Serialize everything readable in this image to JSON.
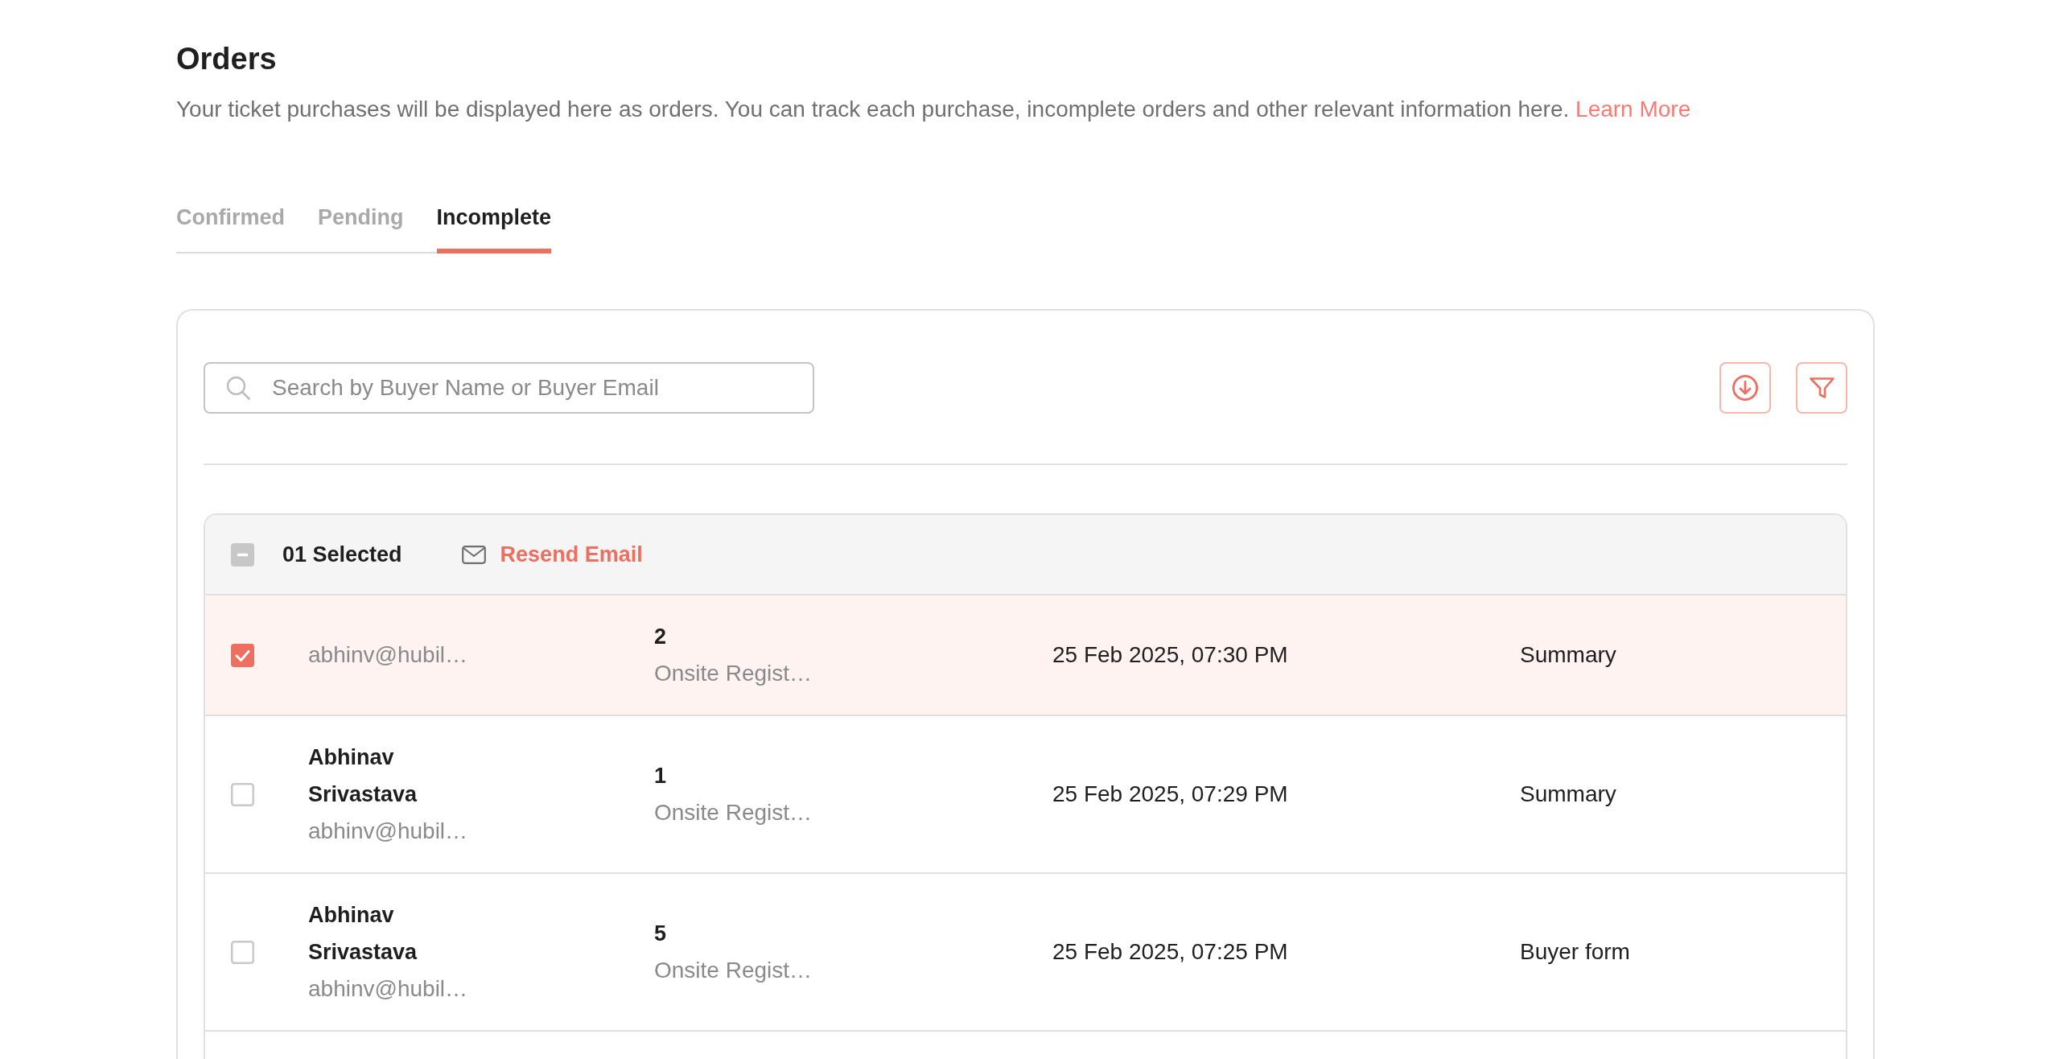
{
  "header": {
    "title": "Orders",
    "description": "Your ticket purchases will be displayed here as orders. You can track each purchase, incomplete orders and other relevant information here.",
    "link": "Learn More"
  },
  "tabs": [
    {
      "label": "Confirmed",
      "selected": false
    },
    {
      "label": "Pending",
      "selected": false
    },
    {
      "label": "Incomplete",
      "selected": true
    }
  ],
  "search": {
    "placeholder": "Search by Buyer Name or Buyer Email"
  },
  "selection_bar": {
    "select_all": {
      "indeterminate": true
    },
    "count": "01 Selected",
    "action": "Resend Email"
  },
  "rows": [
    {
      "selected": true,
      "email": "abhinv@hubil…",
      "ticket_count": "2",
      "ticket_name": "Onsite Regist…",
      "date": "25 Feb 2025, 07:30 PM",
      "step": "Summary"
    },
    {
      "selected": false,
      "name": "Abhinav Srivastava",
      "email": "abhinv@hubil…",
      "ticket_count": "1",
      "ticket_name": "Onsite Regist…",
      "date": "25 Feb 2025, 07:29 PM",
      "step": "Summary"
    },
    {
      "selected": false,
      "name": "Abhinav Srivastava",
      "email": "abhinv@hubil…",
      "ticket_count": "5",
      "ticket_name": "Onsite Regist…",
      "date": "25 Feb 2025, 07:25 PM",
      "step": "Buyer form"
    }
  ]
}
